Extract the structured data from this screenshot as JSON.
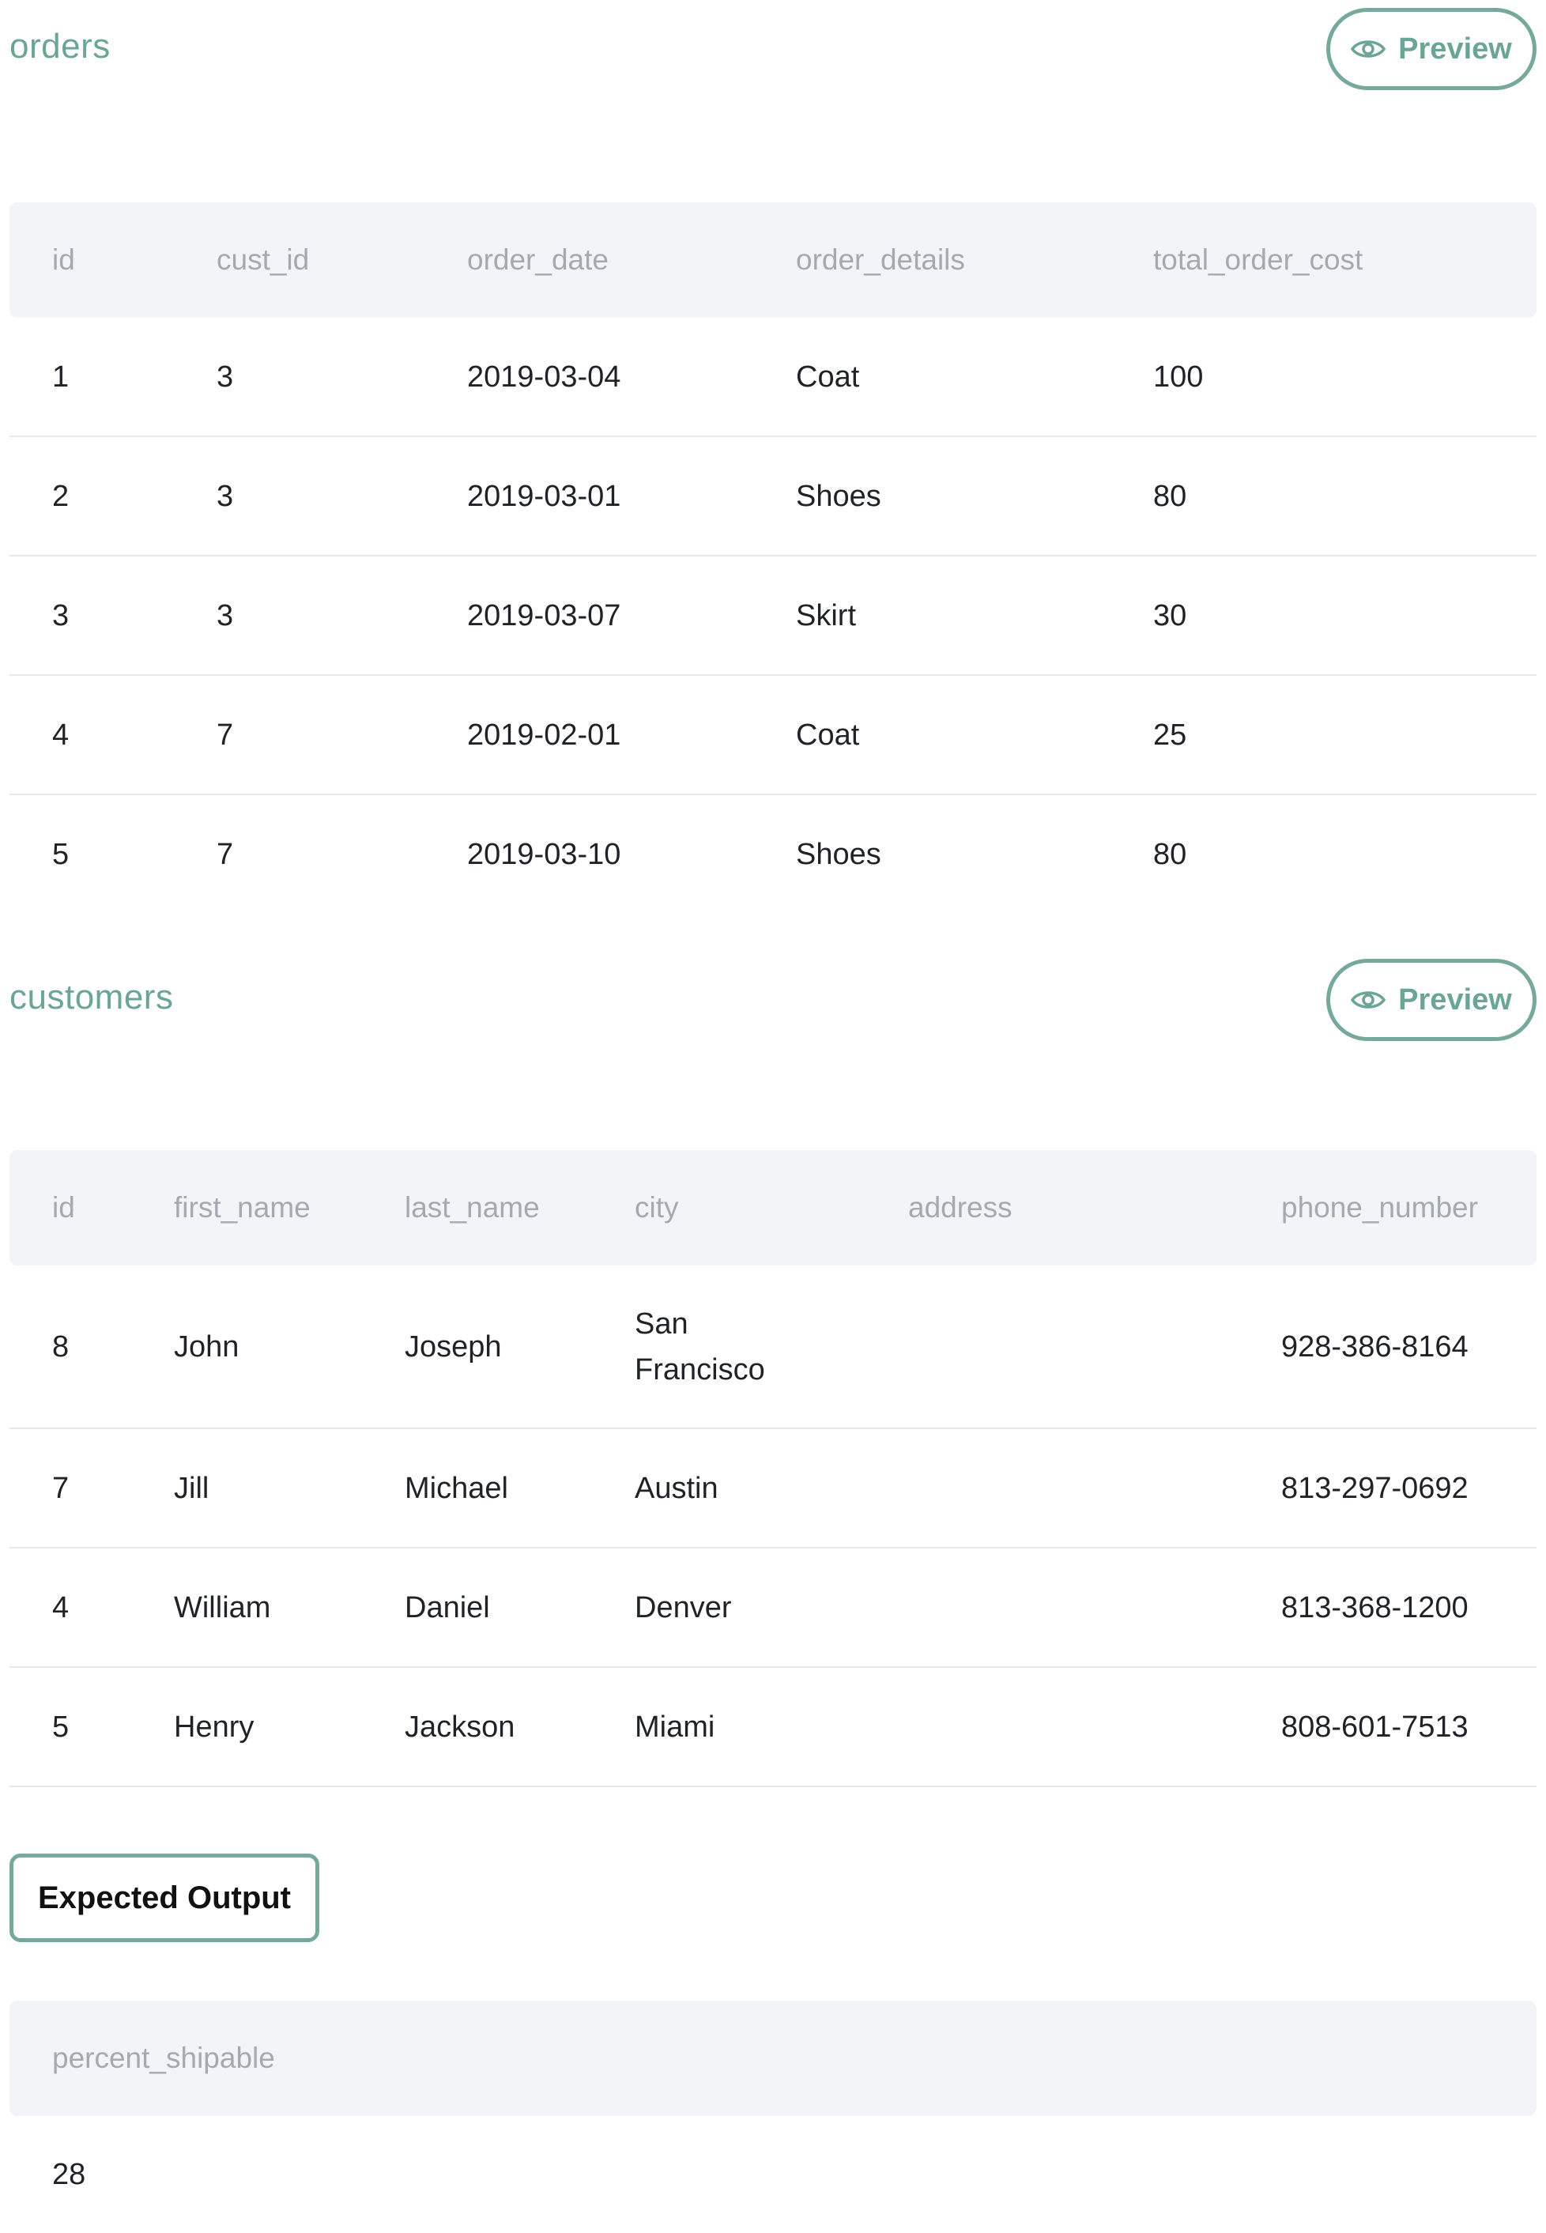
{
  "orders": {
    "title": "orders",
    "preview_label": "Preview",
    "columns": [
      "id",
      "cust_id",
      "order_date",
      "order_details",
      "total_order_cost"
    ],
    "rows": [
      [
        "1",
        "3",
        "2019-03-04",
        "Coat",
        "100"
      ],
      [
        "2",
        "3",
        "2019-03-01",
        "Shoes",
        "80"
      ],
      [
        "3",
        "3",
        "2019-03-07",
        "Skirt",
        "30"
      ],
      [
        "4",
        "7",
        "2019-02-01",
        "Coat",
        "25"
      ],
      [
        "5",
        "7",
        "2019-03-10",
        "Shoes",
        "80"
      ]
    ]
  },
  "customers": {
    "title": "customers",
    "preview_label": "Preview",
    "columns": [
      "id",
      "first_name",
      "last_name",
      "city",
      "address",
      "phone_number"
    ],
    "rows": [
      [
        "8",
        "John",
        "Joseph",
        "San Francisco",
        "",
        "928-386-8164"
      ],
      [
        "7",
        "Jill",
        "Michael",
        "Austin",
        "",
        "813-297-0692"
      ],
      [
        "4",
        "William",
        "Daniel",
        "Denver",
        "",
        "813-368-1200"
      ],
      [
        "5",
        "Henry",
        "Jackson",
        "Miami",
        "",
        "808-601-7513"
      ]
    ]
  },
  "expected_output": {
    "button_label": "Expected Output",
    "columns": [
      "percent_shipable"
    ],
    "rows": [
      [
        "28"
      ]
    ]
  },
  "colors": {
    "accent": "#6aa596",
    "header_bg": "#f3f4f8",
    "header_text": "#a4a9b2"
  },
  "icons": {
    "preview": "eye-icon"
  }
}
